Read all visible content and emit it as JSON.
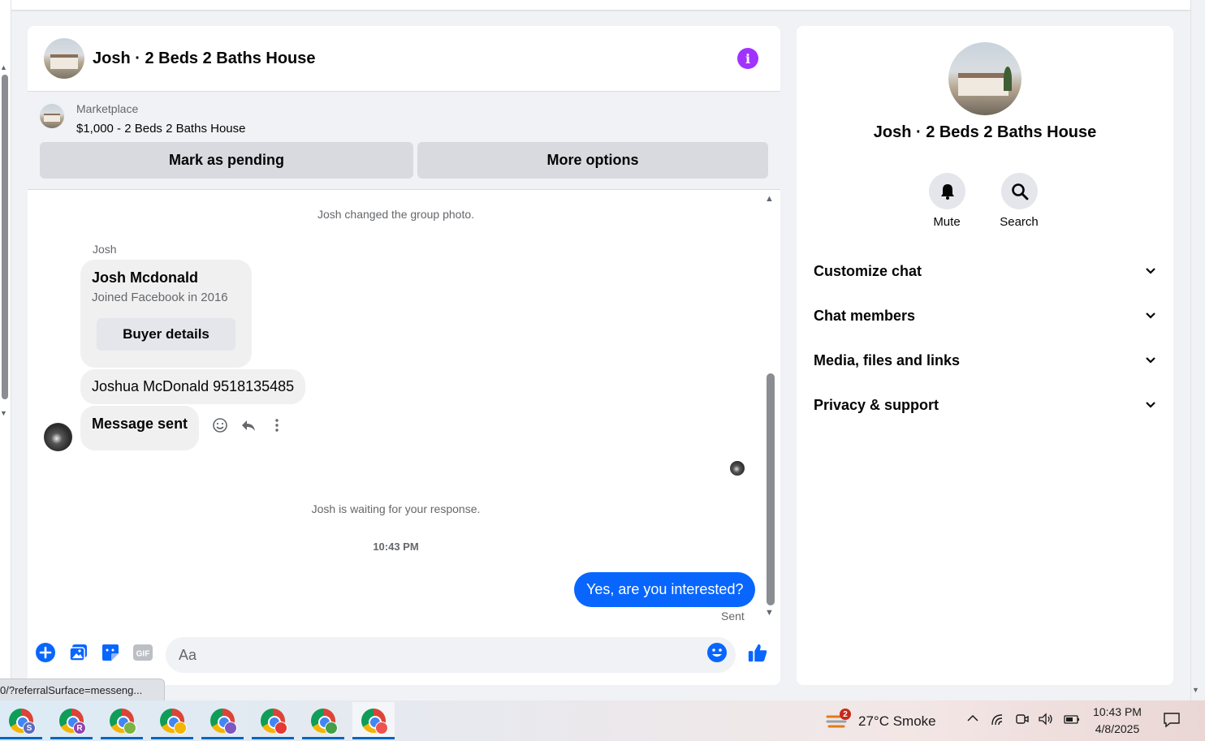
{
  "chat": {
    "title": "Josh · 2 Beds 2 Baths House",
    "marketplace_label": "Marketplace",
    "listing": "$1,000 - 2 Beds 2 Baths House",
    "mark_pending": "Mark as pending",
    "more_options": "More options"
  },
  "messages": {
    "system_photo": "Josh changed the group photo.",
    "sender": "Josh",
    "profile_name": "Josh Mcdonald",
    "profile_sub": "Joined Facebook in 2016",
    "buyer_details": "Buyer details",
    "phone_message": "Joshua McDonald 9518135485",
    "sent_message": "Message sent",
    "waiting": "Josh is waiting for your response.",
    "time": "10:43 PM",
    "reply": "Yes, are you interested?",
    "status": "Sent"
  },
  "composer": {
    "placeholder": "Aa",
    "icons": [
      "plus-circle-icon",
      "photo-icon",
      "sticker-icon",
      "gif-icon",
      "emoji-icon",
      "thumbs-up-icon"
    ]
  },
  "panel": {
    "title": "Josh · 2 Beds 2 Baths House",
    "mute": "Mute",
    "search": "Search",
    "sections": [
      "Customize chat",
      "Chat members",
      "Media, files and links",
      "Privacy & support"
    ]
  },
  "status_url": "0/?referralSurface=messeng...",
  "taskbar": {
    "weather": "27°C  Smoke",
    "weather_badge": "2",
    "time": "10:43 PM",
    "date": "4/8/2025",
    "apps": [
      {
        "badge": "S",
        "color": "#5c6bc0"
      },
      {
        "badge": "R",
        "color": "#8e44ad"
      },
      {
        "badge": "",
        "color": "#7cb342"
      },
      {
        "badge": "",
        "color": "#f4b400"
      },
      {
        "badge": "",
        "color": "#7e57c2"
      },
      {
        "badge": "",
        "color": "#e53935"
      },
      {
        "badge": "",
        "color": "#43a047"
      },
      {
        "badge": "",
        "color": "#ef5350"
      }
    ]
  },
  "colors": {
    "accent_blue": "#0866ff",
    "info_purple": "#a033ff"
  }
}
